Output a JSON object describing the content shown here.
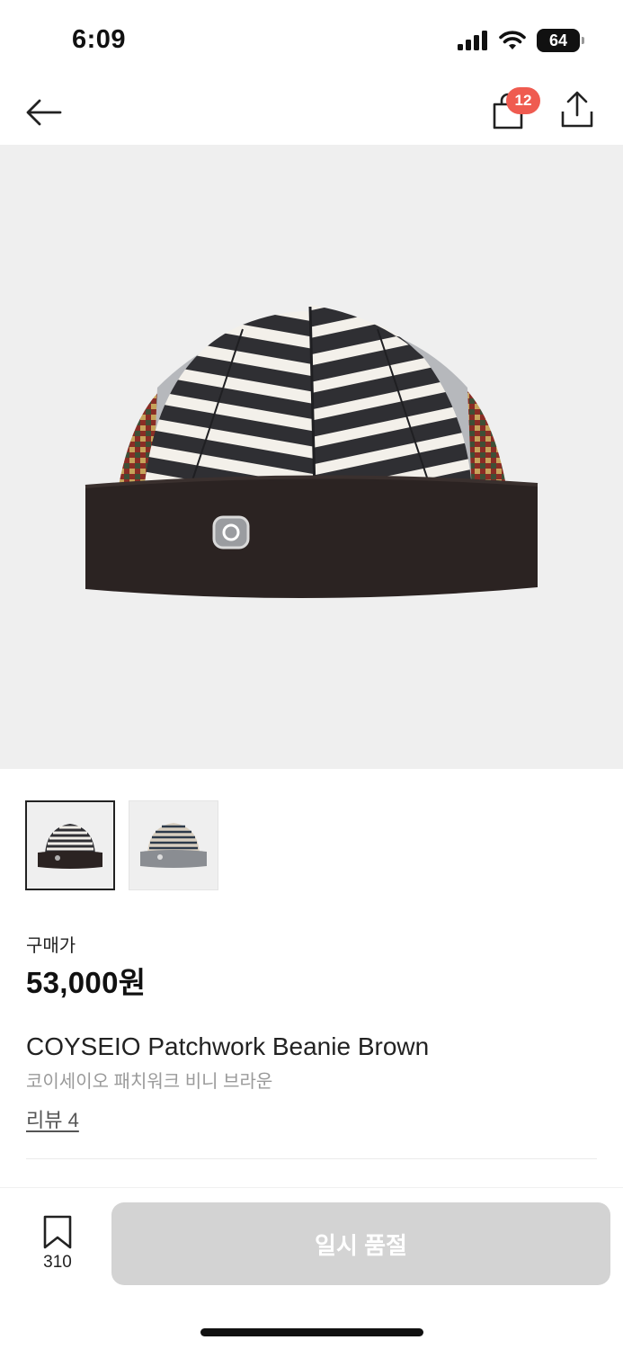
{
  "status_bar": {
    "time": "6:09",
    "battery": "64"
  },
  "nav": {
    "cart_count": "12"
  },
  "product": {
    "price_label": "구매가",
    "price": "53,000원",
    "name": "COYSEIO Patchwork Beanie Brown",
    "name_ko": "코이세이오 패치워크 비니 브라운",
    "reviews": "리뷰 4"
  },
  "thumbnails": [
    {
      "colorway": "brown",
      "selected": true
    },
    {
      "colorway": "grey",
      "selected": false
    }
  ],
  "bottom_bar": {
    "bookmark_count": "310",
    "buy_label": "일시 품절",
    "buy_enabled": false
  },
  "colors": {
    "badge": "#ef5b50",
    "hero_bg": "#efefef",
    "disabled_button": "#d3d3d3"
  },
  "icons": [
    "back-arrow-icon",
    "shopping-bag-icon",
    "share-icon",
    "bookmark-icon",
    "signal-icon",
    "wifi-icon",
    "battery-icon"
  ]
}
